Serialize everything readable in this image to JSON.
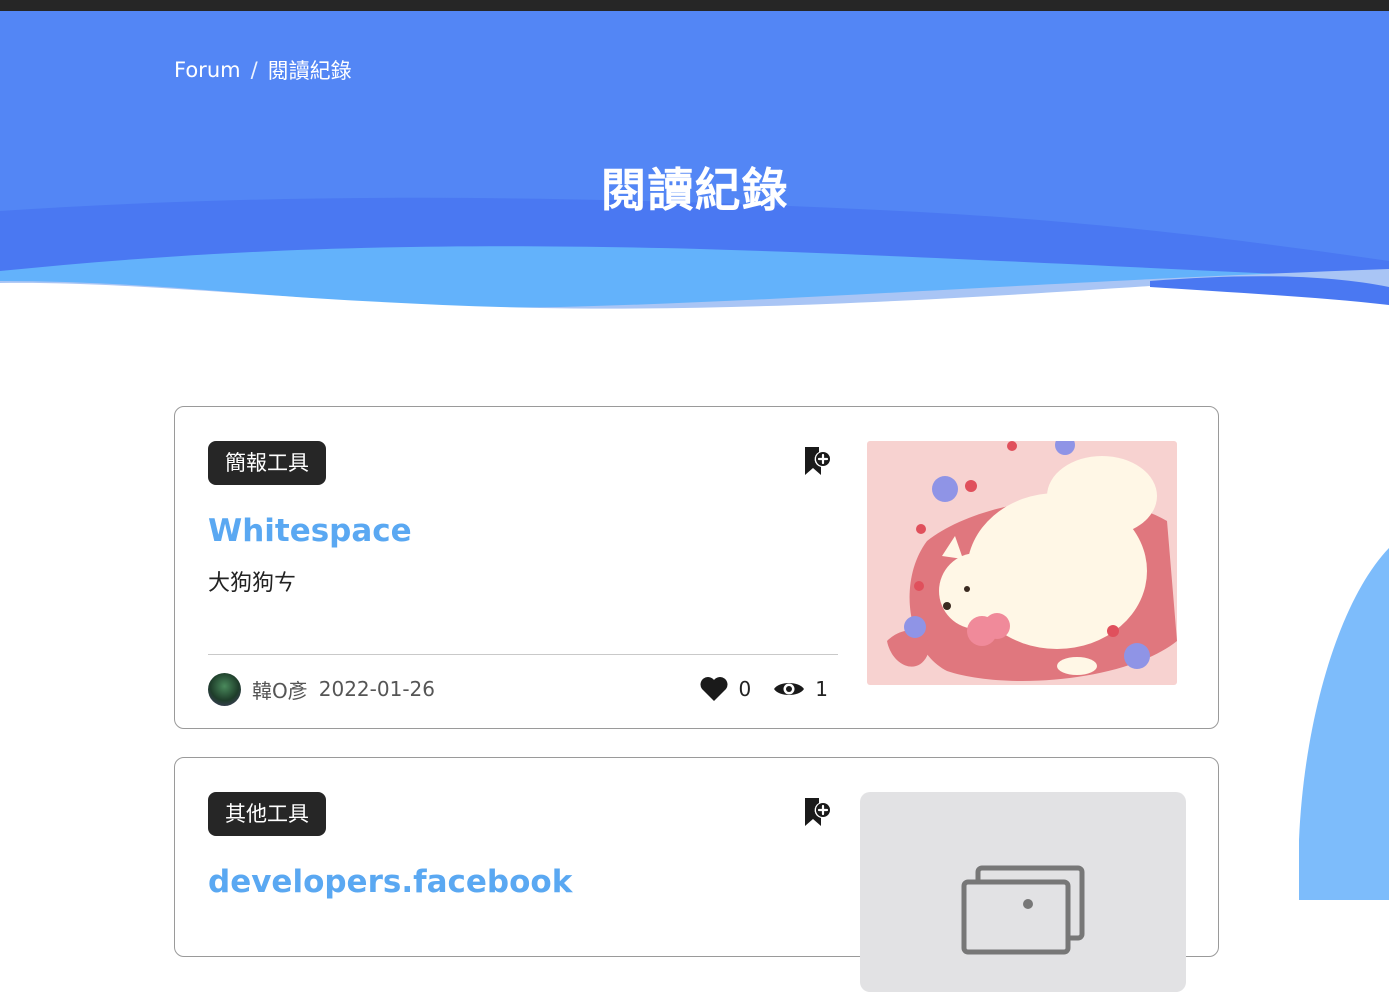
{
  "breadcrumb": {
    "root": "Forum",
    "separator": "/",
    "current": "閱讀紀錄"
  },
  "page": {
    "title": "閱讀紀錄"
  },
  "colors": {
    "hero": "#5386f5",
    "accent": "#5aa8f2",
    "tag_bg": "#262626"
  },
  "posts": [
    {
      "tag": "簡報工具",
      "title": "Whitespace",
      "description": "大狗狗ㄘ",
      "author": "韓O彥",
      "date": "2022-01-26",
      "likes": "0",
      "views": "1",
      "icons": [
        "bookmark-plus-icon",
        "heart-icon",
        "eye-icon"
      ]
    },
    {
      "tag": "其他工具",
      "title": "developers.facebook",
      "icons": [
        "bookmark-plus-icon",
        "image-placeholder-icon"
      ]
    }
  ]
}
